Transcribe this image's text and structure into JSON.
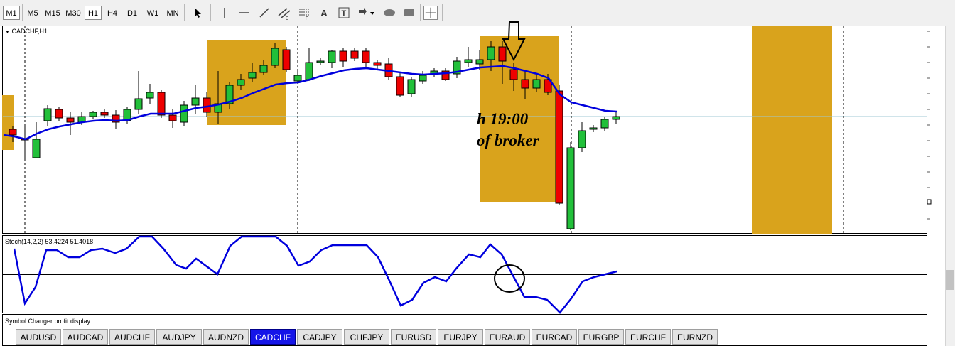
{
  "toolbar": {
    "timeframes": [
      "M1",
      "M5",
      "M15",
      "M30",
      "H1",
      "H4",
      "D1",
      "W1",
      "MN"
    ],
    "active_timeframe": "H1",
    "first_timeframe": "M1",
    "tools": [
      "cursor-arrow-icon",
      "crosshair-vertical-line-icon",
      "horizontal-line-icon",
      "trendline-icon",
      "equidistant-channel-icon",
      "fibonacci-icon",
      "text-icon",
      "text-label-icon",
      "arrow-marker-icon",
      "ellipse-icon",
      "rectangle-icon",
      "crosshair-icon"
    ],
    "text_tool_label": "A"
  },
  "chart": {
    "symbol_label": "CADCHF,H1",
    "annotation_line1": "h 19:00",
    "annotation_line2": "of broker",
    "ma_color": "#0000dd",
    "bull_color": "#22c03a",
    "bear_color": "#ee0000",
    "zone_color": "#d9a31c",
    "current_price_line_color": "#a0c8d4"
  },
  "stochastic": {
    "label": "Stoch(14,2,2) 53.4224 51.4018",
    "main": 53.4224,
    "signal": 51.4018,
    "line_color": "#0000dd",
    "level_line_color": "#000000"
  },
  "symbol_changer": {
    "title": "Symbol Changer profit display",
    "symbols": [
      "AUDUSD",
      "AUDCAD",
      "AUDCHF",
      "AUDJPY",
      "AUDNZD",
      "CADCHF",
      "CADJPY",
      "CHFJPY",
      "EURUSD",
      "EURJPY",
      "EURAUD",
      "EURCAD",
      "EURGBP",
      "EURCHF",
      "EURNZD"
    ],
    "active_symbol": "CADCHF"
  }
}
